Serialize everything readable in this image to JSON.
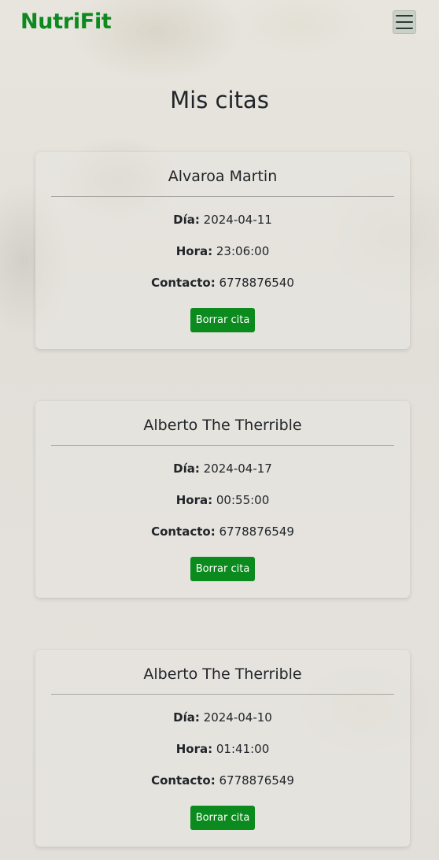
{
  "navbar": {
    "brand": "NutriFit",
    "toggler_icon": "hamburger-menu-icon"
  },
  "page": {
    "title": "Mis citas"
  },
  "labels": {
    "dia": "Día:",
    "hora": "Hora:",
    "contacto": "Contacto:",
    "delete_button": "Borrar cita"
  },
  "appointments": [
    {
      "name": "Alvaroa Martin",
      "dia": "2024-04-11",
      "hora": "23:06:00",
      "contacto": "6778876540"
    },
    {
      "name": "Alberto The Therrible",
      "dia": "2024-04-17",
      "hora": "00:55:00",
      "contacto": "6778876549"
    },
    {
      "name": "Alberto The Therrible",
      "dia": "2024-04-10",
      "hora": "01:41:00",
      "contacto": "6778876549"
    }
  ],
  "colors": {
    "brand": "#0d8a1f",
    "button": "#0b8a1e"
  }
}
